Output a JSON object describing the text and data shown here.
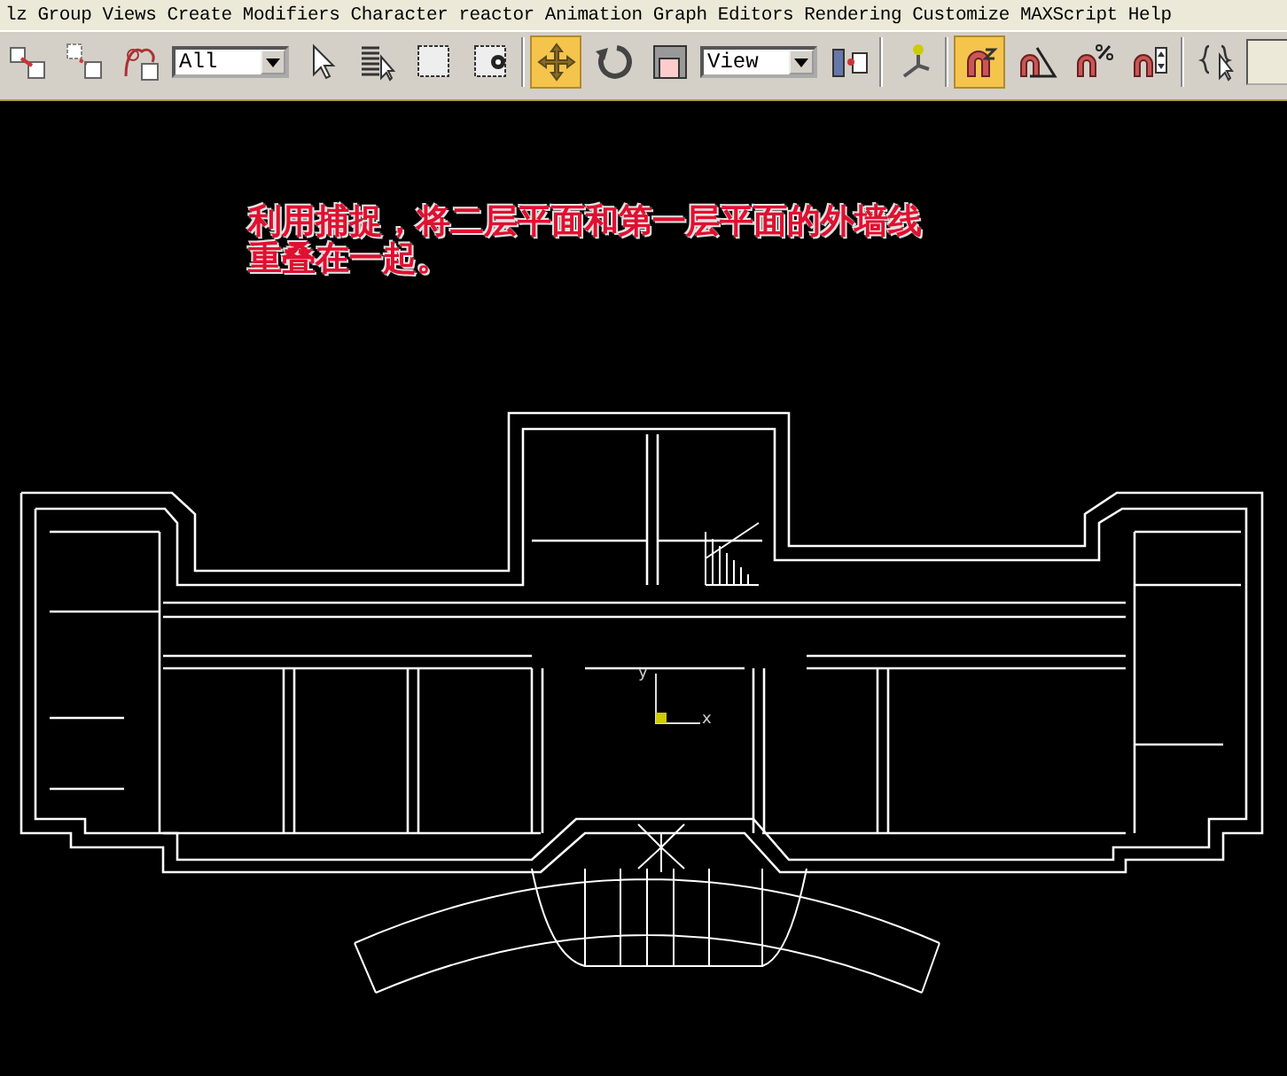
{
  "menu_bar": {
    "items": [
      "lz",
      "Group",
      "Views",
      "Create",
      "Modifiers",
      "Character",
      "reactor",
      "Animation",
      "Graph Editors",
      "Rendering",
      "Customize",
      "MAXScript",
      "Help"
    ]
  },
  "toolbar": {
    "items": [
      {
        "kind": "button",
        "selected": false
      },
      {
        "kind": "button",
        "selected": false
      },
      {
        "kind": "button",
        "selected": false
      },
      {
        "kind": "dropdown",
        "value": "All"
      },
      {
        "kind": "button",
        "selected": false
      },
      {
        "kind": "button",
        "selected": false
      },
      {
        "kind": "button",
        "selected": false
      },
      {
        "kind": "button",
        "selected": false
      },
      {
        "kind": "separator"
      },
      {
        "kind": "button",
        "selected": true
      },
      {
        "kind": "button",
        "selected": false
      },
      {
        "kind": "button",
        "selected": false
      },
      {
        "kind": "dropdown",
        "value": "View"
      },
      {
        "kind": "button",
        "selected": false
      },
      {
        "kind": "separator"
      },
      {
        "kind": "button",
        "selected": false
      },
      {
        "kind": "separator"
      },
      {
        "kind": "button",
        "selected": true
      },
      {
        "kind": "button",
        "selected": false
      },
      {
        "kind": "button",
        "selected": false
      },
      {
        "kind": "button",
        "selected": false
      },
      {
        "kind": "separator"
      },
      {
        "kind": "button",
        "selected": false
      },
      {
        "kind": "field"
      }
    ]
  },
  "viewport": {
    "annotation": [
      "利用捕捉，将二层平面和第一层平面的外墙线",
      "重叠在一起。"
    ],
    "gizmo": {
      "x_label": "x",
      "y_label": "y"
    }
  }
}
